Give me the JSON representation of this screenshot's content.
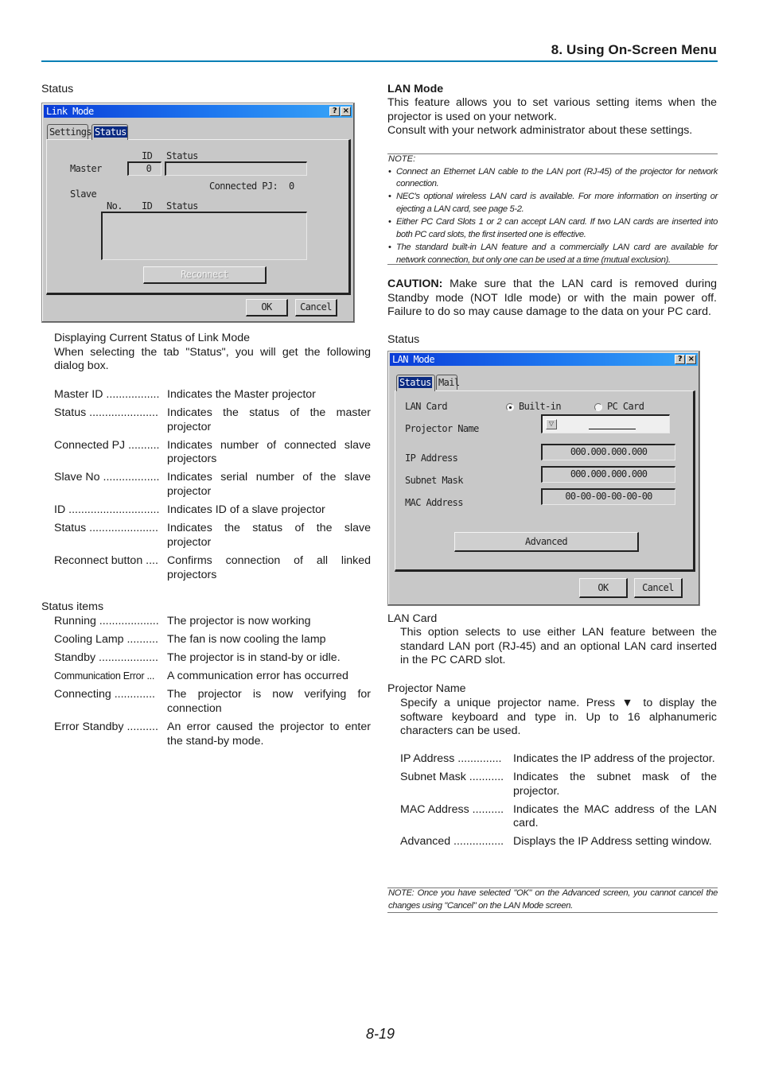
{
  "header": {
    "section_title": "8. Using On-Screen Menu",
    "rule_color": "#0a7fb5"
  },
  "left": {
    "status_label": "Status",
    "link_mode_dialog": {
      "title": "Link Mode",
      "help_glyph": "?",
      "close_glyph": "×",
      "tabs": [
        {
          "label": "Settings",
          "selected": false
        },
        {
          "label": "Status",
          "selected": true
        }
      ],
      "id_header": "ID",
      "status_header": "Status",
      "master_label": "Master",
      "master_id": "0",
      "master_status": "",
      "connected_pj_label": "Connected PJ:",
      "connected_pj_value": "0",
      "slave_label": "Slave",
      "slave_columns": [
        "No.",
        "ID",
        "Status"
      ],
      "reconnect_label": "Reconnect",
      "ok_label": "OK",
      "cancel_label": "Cancel"
    },
    "intro_heading": "Displaying Current Status of Link Mode",
    "intro_text": "When selecting the tab \"Status\", you will get the following dialog box.",
    "definitions": [
      {
        "term": "Master ID .................",
        "desc": "Indicates the Master projector"
      },
      {
        "term": "Status ......................",
        "desc": "Indicates the status of the master projector"
      },
      {
        "term": "Connected PJ ..........",
        "desc": "Indicates number of connected slave projectors"
      },
      {
        "term": "Slave No ..................",
        "desc": "Indicates serial number of the slave projector"
      },
      {
        "term": "ID .............................",
        "desc": "Indicates ID of a slave projector"
      },
      {
        "term": "Status ......................",
        "desc": "Indicates the status of the slave projector"
      },
      {
        "term": "Reconnect button ....",
        "desc": "Confirms connection of all linked projectors"
      }
    ],
    "status_items_heading": "Status items",
    "status_items": [
      {
        "term": "Running ...................",
        "desc": "The projector is now working"
      },
      {
        "term": "Cooling Lamp ..........",
        "desc": "The fan is now cooling the lamp"
      },
      {
        "term": "Standby ...................",
        "desc": "The projector is in stand-by or idle."
      },
      {
        "term": "Communication Error ...",
        "desc": "A communication error has occurred"
      },
      {
        "term": "Connecting .............",
        "desc": "The projector is now verifying for connection"
      },
      {
        "term": "Error Standby ..........",
        "desc": "An error caused the projector to enter the stand-by mode."
      }
    ]
  },
  "right": {
    "lan_mode_heading": "LAN Mode",
    "lan_mode_text1": "This feature allows you to set various setting items when the projector is used on your network.",
    "lan_mode_text2": "Consult with your network administrator about these settings.",
    "note": {
      "heading": "NOTE:",
      "items": [
        "Connect an Ethernet LAN cable to the LAN port (RJ-45) of the projector for network connection.",
        "NEC's optional wireless LAN card is available. For more information on inserting or ejecting a LAN card, see page 5-2.",
        "Either PC Card Slots 1 or 2 can accept LAN card. If two LAN cards are inserted into both PC card slots, the first inserted one is effective.",
        "The standard built-in LAN feature and a commercially LAN card are available for network connection, but only one can be used at a time (mutual exclusion)."
      ]
    },
    "caution_label": "CAUTION:",
    "caution_text": " Make sure that the LAN card is removed during Standby mode (NOT Idle mode) or with the main power off. Failure to do so may cause damage to the data on your PC card.",
    "status_label": "Status",
    "lan_mode_dialog": {
      "title": "LAN Mode",
      "help_glyph": "?",
      "close_glyph": "×",
      "tabs": [
        {
          "label": "Status",
          "selected": true
        },
        {
          "label": "Mail",
          "selected": false
        }
      ],
      "lan_card_label": "LAN Card",
      "lan_card_options": [
        {
          "label": "Built-in",
          "checked": true
        },
        {
          "label": "PC Card",
          "checked": false
        }
      ],
      "projector_name_label": "Projector Name",
      "projector_name_value": "",
      "dropdown_glyph": "▽",
      "ip_address_label": "IP Address",
      "ip_address_value": "000.000.000.000",
      "subnet_mask_label": "Subnet Mask",
      "subnet_mask_value": "000.000.000.000",
      "mac_address_label": "MAC Address",
      "mac_address_value": "00-00-00-00-00-00",
      "advanced_label": "Advanced",
      "ok_label": "OK",
      "cancel_label": "Cancel"
    },
    "lan_card_heading": "LAN Card",
    "lan_card_text": "This option selects to use either LAN feature between the standard LAN port (RJ-45) and an optional LAN card inserted in the PC CARD slot.",
    "projector_name_heading": "Projector Name",
    "projector_name_text": "Specify a unique projector name. Press ▼ to display the software keyboard and type in. Up to 16 alphanumeric characters can be used.",
    "definitions": [
      {
        "term": "IP Address ..............",
        "desc": "Indicates the IP address of the projector."
      },
      {
        "term": "Subnet Mask ...........",
        "desc": "Indicates the subnet mask of the projector."
      },
      {
        "term": "MAC Address ..........",
        "desc": "Indicates the MAC address of the LAN card."
      },
      {
        "term": "Advanced ................",
        "desc": "Displays the IP Address setting window."
      }
    ],
    "bottom_note": "NOTE: Once you have selected \"OK\" on the Advanced screen, you cannot cancel the changes using \"Cancel\" on the LAN Mode screen."
  },
  "footer": {
    "page_number": "8-19"
  }
}
